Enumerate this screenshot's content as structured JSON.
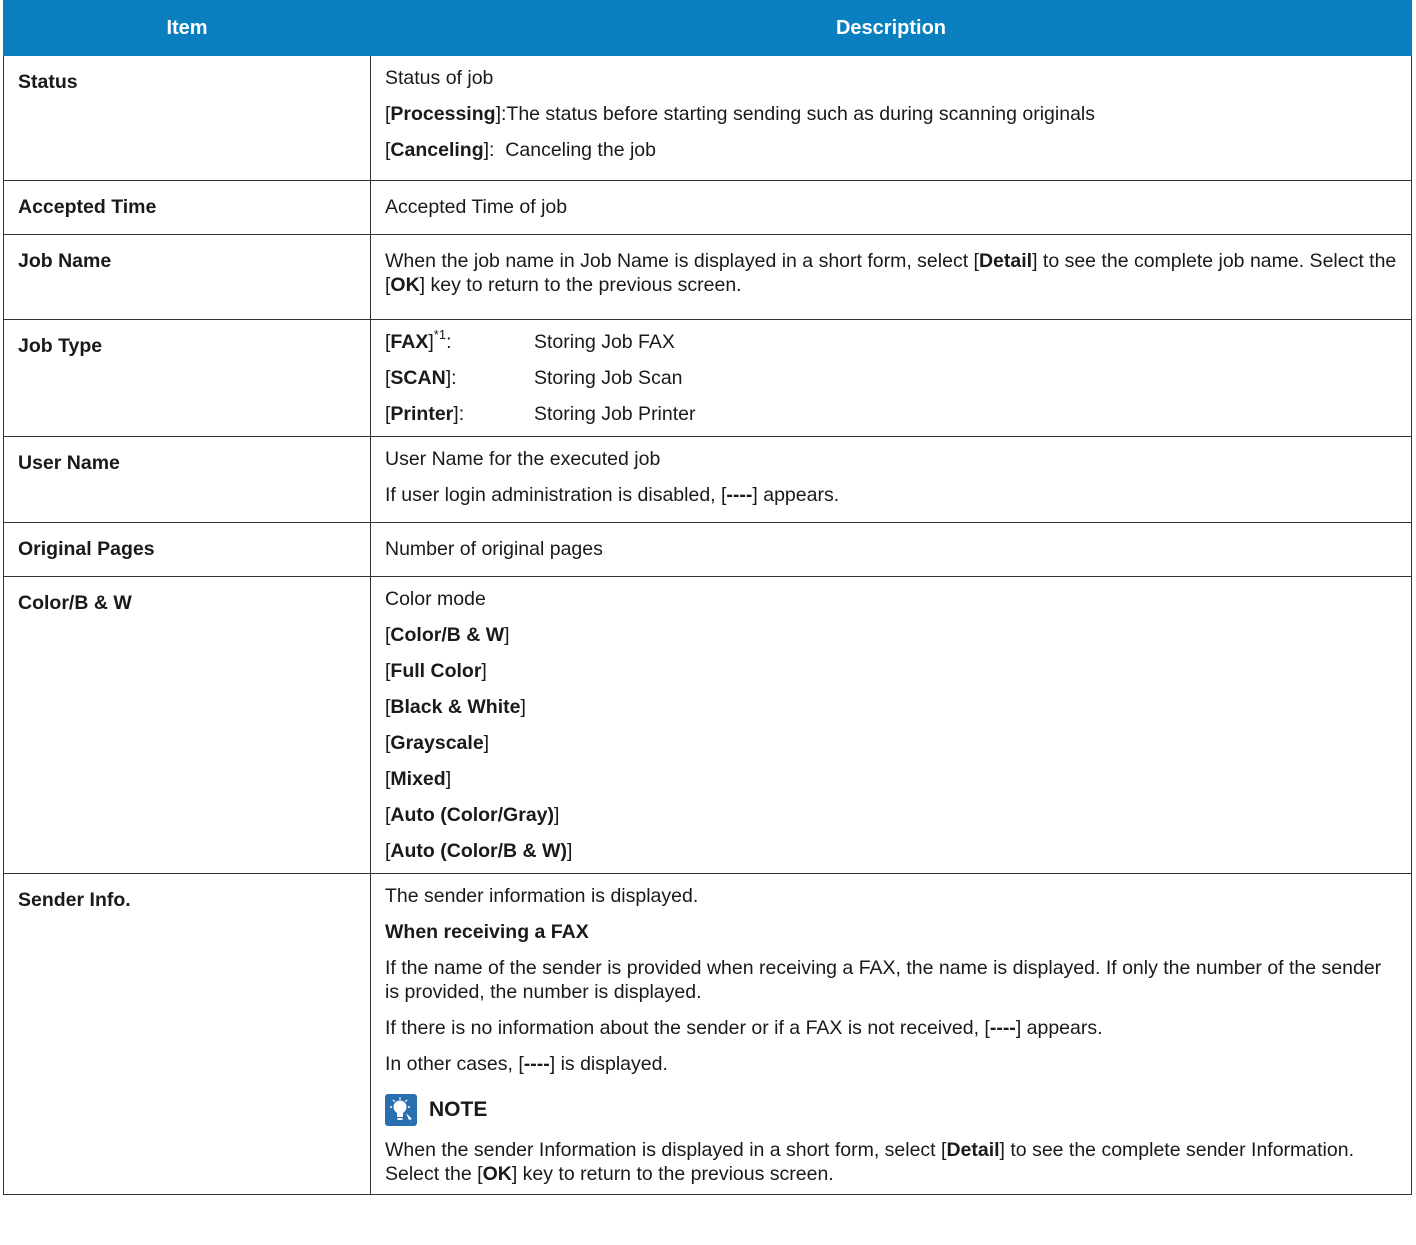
{
  "header": {
    "item": "Item",
    "description": "Description"
  },
  "status": {
    "item": "Status",
    "line1": "Status of job",
    "processing": {
      "key": "Processing",
      "pre": "[",
      "post": "]:",
      "text": "The status before starting sending such as during scanning originals"
    },
    "canceling": {
      "key": "Canceling",
      "pre": "[",
      "post": "]:",
      "text": "Canceling the job"
    }
  },
  "accepted_time": {
    "item": "Accepted Time",
    "text": "Accepted Time of job"
  },
  "job_name": {
    "item": "Job Name",
    "t1": "When the job name in Job Name is displayed in a short form, select [",
    "b1": "Detail",
    "t2": "] to see the complete job name. Select the [",
    "b2": "OK",
    "t3": "] key to return to the previous screen."
  },
  "job_type": {
    "item": "Job Type",
    "rows": [
      {
        "key": "FAX",
        "sup": "*1",
        "post": ":",
        "text": "Storing Job FAX"
      },
      {
        "key": "SCAN",
        "sup": "",
        "post": ":",
        "text": "Storing Job Scan"
      },
      {
        "key": "Printer",
        "sup": "",
        "post": ":",
        "text": "Storing Job Printer"
      }
    ]
  },
  "user_name": {
    "item": "User Name",
    "line1": "User Name for the executed job",
    "line2_pre": "If user login administration is disabled, [",
    "line2_bold": "----",
    "line2_post": "] appears."
  },
  "original_pages": {
    "item": "Original Pages",
    "text": "Number of original pages"
  },
  "color": {
    "item": "Color/B & W",
    "line1": "Color mode",
    "options": [
      "Color/B & W",
      "Full Color",
      "Black & White",
      "Grayscale",
      "Mixed",
      "Auto (Color/Gray)",
      "Auto (Color/B & W)"
    ]
  },
  "sender": {
    "item": "Sender Info.",
    "line1": "The sender information is displayed.",
    "heading": "When receiving a FAX",
    "p1": "If the name of the sender is provided when receiving a FAX, the name is displayed. If only the number of the sender is provided, the number is displayed.",
    "p2_pre": "If there is no information about the sender or if a FAX is not received, [",
    "p2_bold": "----",
    "p2_post": "] appears.",
    "p3_pre": "In other cases, [",
    "p3_bold": "----",
    "p3_post": "] is displayed.",
    "note_label": "NOTE",
    "note_t1": "When the sender Information is displayed in a short form, select [",
    "note_b1": "Detail",
    "note_t2": "] to see the complete sender Information. Select the [",
    "note_b2": "OK",
    "note_t3": "] key to return to the previous screen."
  }
}
